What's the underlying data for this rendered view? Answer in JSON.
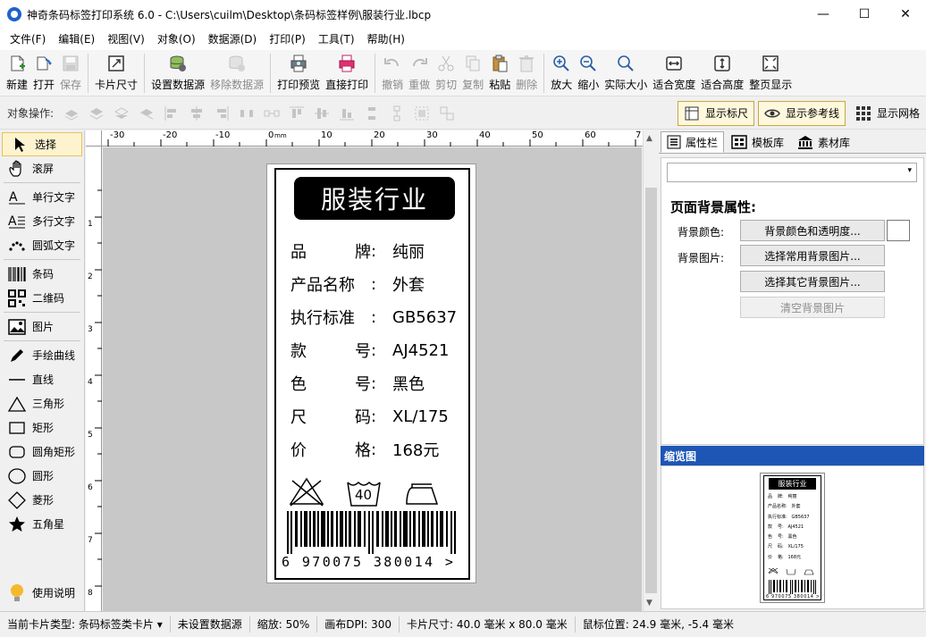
{
  "window": {
    "title": "神奇条码标签打印系统 6.0 - C:\\Users\\cuilm\\Desktop\\条码标签样例\\服装行业.lbcp",
    "minimize": "—",
    "maximize": "☐",
    "close": "✕"
  },
  "menu": [
    "文件(F)",
    "编辑(E)",
    "视图(V)",
    "对象(O)",
    "数据源(D)",
    "打印(P)",
    "工具(T)",
    "帮助(H)"
  ],
  "toolbar": {
    "new": "新建",
    "open": "打开",
    "save": "保存",
    "card_size": "卡片尺寸",
    "set_datasource": "设置数据源",
    "remove_datasource": "移除数据源",
    "print_preview": "打印预览",
    "direct_print": "直接打印",
    "undo": "撤销",
    "redo": "重做",
    "cut": "剪切",
    "copy": "复制",
    "paste": "粘贴",
    "delete": "删除",
    "zoom_in": "放大",
    "zoom_out": "缩小",
    "actual_size": "实际大小",
    "fit_width": "适合宽度",
    "fit_height": "适合高度",
    "fit_page": "整页显示"
  },
  "objbar": {
    "label": "对象操作:",
    "show_ruler": "显示标尺",
    "show_guides": "显示参考线",
    "show_grid": "显示网格"
  },
  "tools": {
    "select": "选择",
    "scroll": "滚屏",
    "single_text": "单行文字",
    "multi_text": "多行文字",
    "arc_text": "圆弧文字",
    "barcode": "条码",
    "qrcode": "二维码",
    "image": "图片",
    "freehand": "手绘曲线",
    "line": "直线",
    "triangle": "三角形",
    "rect": "矩形",
    "round_rect": "圆角矩形",
    "circle": "圆形",
    "diamond": "菱形",
    "star": "五角星",
    "help": "使用说明"
  },
  "ruler": {
    "h_ticks": [
      "-30",
      "-20",
      "-10",
      "0",
      "10",
      "20",
      "30",
      "40",
      "50",
      "60",
      "7"
    ],
    "h_unit": "mm",
    "v_ticks": [
      "1",
      "2",
      "3",
      "4",
      "5",
      "6",
      "7",
      "8"
    ]
  },
  "label": {
    "title": "服装行业",
    "fields": [
      {
        "k1": "品",
        "k2": "牌",
        "v": "纯丽"
      },
      {
        "k1": "产品名称",
        "k2": "",
        "v": "外套"
      },
      {
        "k1": "执行标准",
        "k2": "",
        "v": "GB5637"
      },
      {
        "k1": "款",
        "k2": "号",
        "v": "AJ4521"
      },
      {
        "k1": "色",
        "k2": "号",
        "v": "黑色"
      },
      {
        "k1": "尺",
        "k2": "码",
        "v": "XL/175"
      },
      {
        "k1": "价",
        "k2": "格",
        "v": "168元"
      }
    ],
    "colon": ":",
    "wash_temp": "40",
    "barcode_number": "6 970075 380014 >"
  },
  "panel": {
    "tabs": [
      "属性栏",
      "模板库",
      "素材库"
    ],
    "section_title": "页面背景属性:",
    "bg_color_label": "背景颜色:",
    "bg_image_label": "背景图片:",
    "btn_color": "背景颜色和透明度...",
    "btn_common_bg": "选择常用背景图片...",
    "btn_other_bg": "选择其它背景图片...",
    "btn_clear_bg": "清空背景图片",
    "preview_title": "缩览图"
  },
  "status": {
    "card_type": "当前卡片类型:  条码标签类卡片",
    "datasource": "未设置数据源",
    "zoom": "缩放:  50%",
    "dpi": "画布DPI:  300",
    "card_size": "卡片尺寸:  40.0 毫米 x 80.0 毫米",
    "mouse_pos": "鼠标位置:  24.9 毫米,  -5.4 毫米"
  }
}
